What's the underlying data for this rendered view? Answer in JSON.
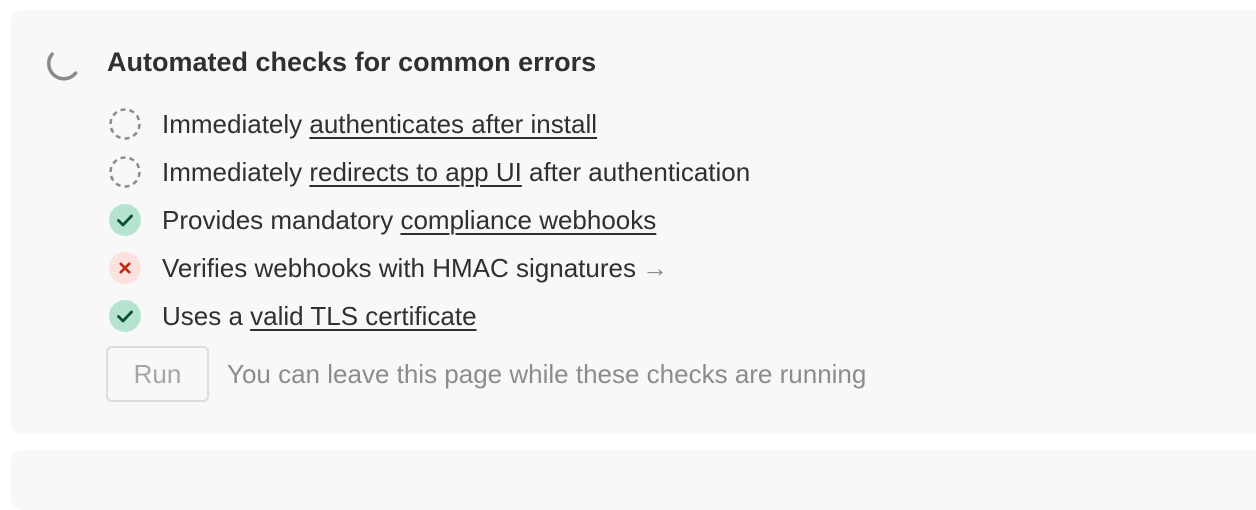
{
  "section": {
    "title": "Automated checks for common errors",
    "status_icon": "loading-spinner-icon"
  },
  "checks": [
    {
      "status": "pending",
      "prefix": "Immediately ",
      "link": "authenticates after install",
      "suffix": ""
    },
    {
      "status": "pending",
      "prefix": "Immediately ",
      "link": "redirects to app UI",
      "suffix": " after authentication"
    },
    {
      "status": "passed",
      "prefix": "Provides mandatory ",
      "link": "compliance webhooks",
      "suffix": ""
    },
    {
      "status": "failed",
      "text": "Verifies webhooks with HMAC signatures",
      "arrow": "→"
    },
    {
      "status": "passed",
      "prefix": "Uses a ",
      "link": "valid TLS certificate",
      "suffix": ""
    }
  ],
  "run": {
    "button_label": "Run",
    "hint": "You can leave this page while these checks are running"
  },
  "colors": {
    "card_background": "#f7f8f7",
    "pass_background": "#b4e4cf",
    "pass_check": "#0c5132",
    "fail_background": "#fde1dc",
    "fail_x": "#c02a17",
    "pending_ring": "#8a8a8a"
  }
}
